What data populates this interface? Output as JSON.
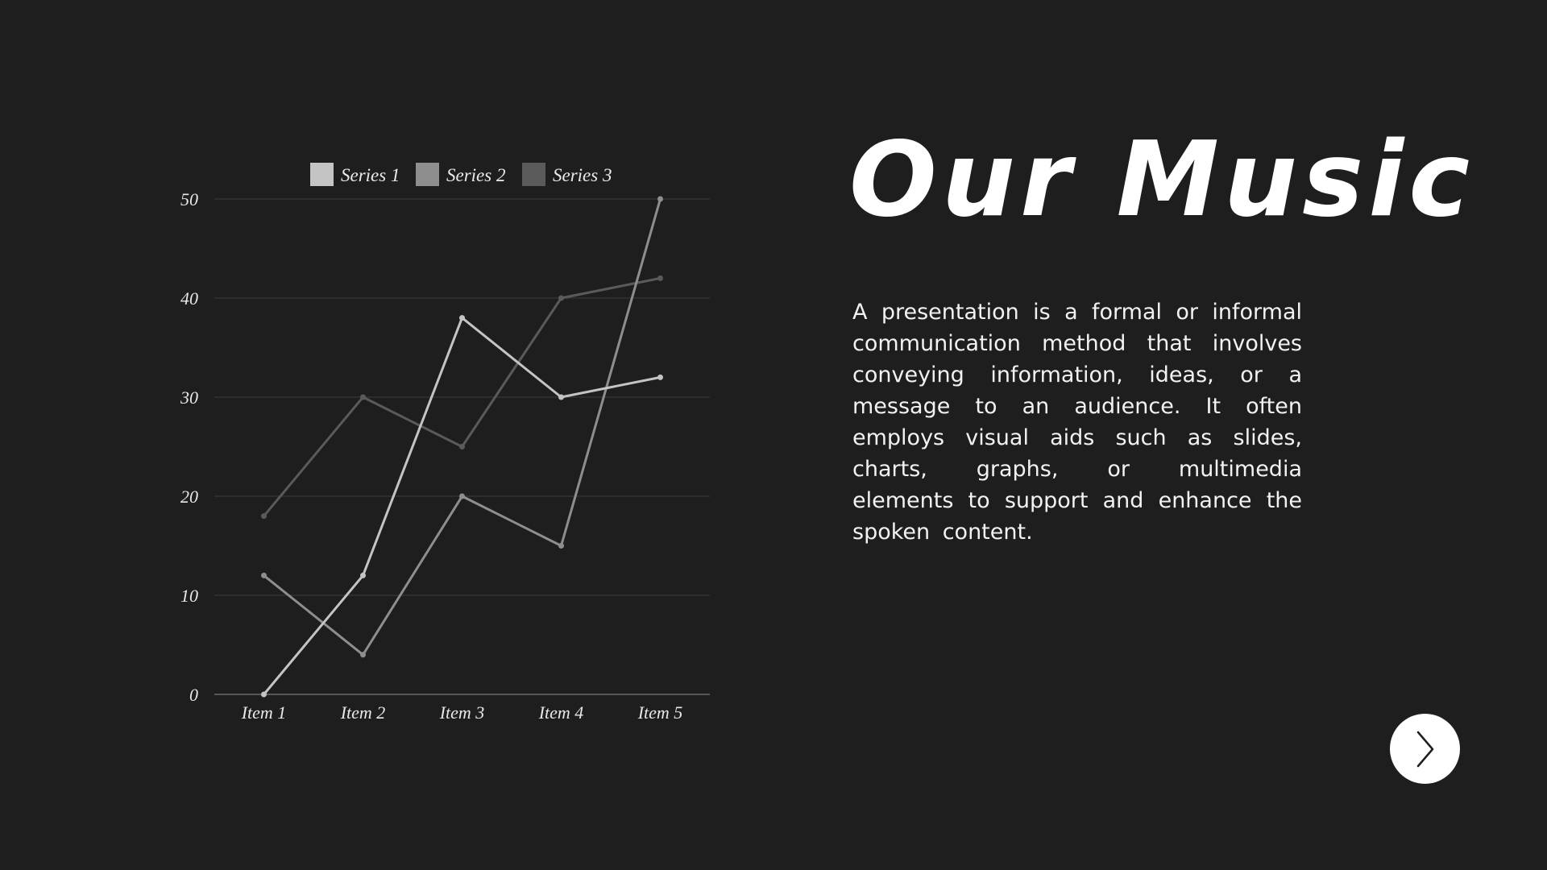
{
  "slide": {
    "title": "Our Music",
    "body": "A presentation is a formal or informal communication method that involves conveying information, ideas, or a message to an audience. It often employs visual aids such as slides, charts, graphs, or multimedia elements to support and enhance the spoken content."
  },
  "navigation": {
    "next_icon": "chevron-right-icon"
  },
  "chart_data": {
    "type": "line",
    "categories": [
      "Item 1",
      "Item 2",
      "Item 3",
      "Item 4",
      "Item 5"
    ],
    "series": [
      {
        "name": "Series 1",
        "values": [
          0,
          12,
          38,
          30,
          32
        ],
        "color": "#c4c4c4"
      },
      {
        "name": "Series 2",
        "values": [
          12,
          4,
          20,
          15,
          50
        ],
        "color": "#8e8e8e"
      },
      {
        "name": "Series 3",
        "values": [
          18,
          30,
          25,
          40,
          42
        ],
        "color": "#5a5a5a"
      }
    ],
    "yticks": [
      0,
      10,
      20,
      30,
      40,
      50
    ],
    "ylim": [
      0,
      50
    ],
    "grid": true,
    "legend": "top"
  }
}
